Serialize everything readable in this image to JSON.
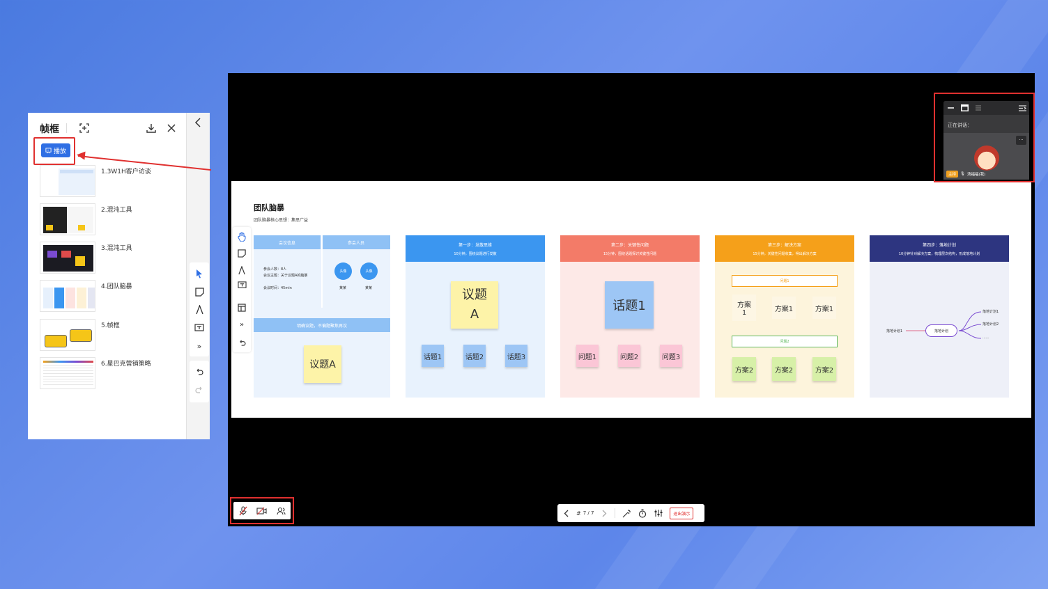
{
  "panel": {
    "title": "帧框",
    "play_label": "播放",
    "frames": [
      {
        "label": "1.3W1H客户访谈"
      },
      {
        "label": "2.混沌工具"
      },
      {
        "label": "3.混沌工具"
      },
      {
        "label": "4.团队脑暴"
      },
      {
        "label": "5.帧框"
      },
      {
        "label": "6.星巴克营销策略"
      }
    ]
  },
  "slide": {
    "title": "团队脑暴",
    "subtitle": "团队脑暴核心思想：集思广益",
    "info": {
      "head1": "会议信息",
      "head2": "参会人员",
      "line1": "参会人数：8人",
      "line2": "会议主题：关于议题A的脑暴",
      "line3": "会议时间：45min",
      "avatar_text": "头像",
      "name_text": "某某",
      "clarify": "明确议题，不偏题聚焦再议",
      "topic": "议题A"
    },
    "step1": {
      "title": "第一步：发散思维",
      "desc": "10分钟，围绕议题进行发散",
      "topic_line1": "议题",
      "topic_line2": "A",
      "notes": [
        "话题1",
        "话题2",
        "话题3"
      ]
    },
    "step2": {
      "title": "第二步：关键性问题",
      "desc": "15分钟，围绕话题探讨关键性问题",
      "topic": "话题1",
      "notes": [
        "问题1",
        "问题2",
        "问题3"
      ]
    },
    "step3": {
      "title": "第三步：解决方案",
      "desc": "15分钟，关键性问题收集，得出解决方案",
      "q1": "问题1",
      "q2": "问题2",
      "row1_a_1": "方案",
      "row1_a_2": "1",
      "row1_b": "方案1",
      "row1_c": "方案1",
      "row2": [
        "方案2",
        "方案2",
        "方案2"
      ]
    },
    "step4": {
      "title": "第四步：落地计划",
      "desc": "10分钟针对解决方案，梳理层次结构，形成落地计划",
      "root": "落地计划",
      "left": "落地计划1",
      "branches": [
        "落地计划1",
        "落地计划2",
        "......"
      ]
    }
  },
  "speaker": {
    "label": "正在讲话：",
    "host": "主持",
    "name": "汤福福(我)",
    "more": "···"
  },
  "controls": {
    "page": "7 / 7",
    "exit": "退出演示"
  },
  "colors": {
    "accent": "#2f6fe4",
    "highlight": "#e0302f",
    "step1": "#3b96f0",
    "step2": "#f37b68",
    "step3": "#f5a01a",
    "step4": "#2d3580"
  }
}
